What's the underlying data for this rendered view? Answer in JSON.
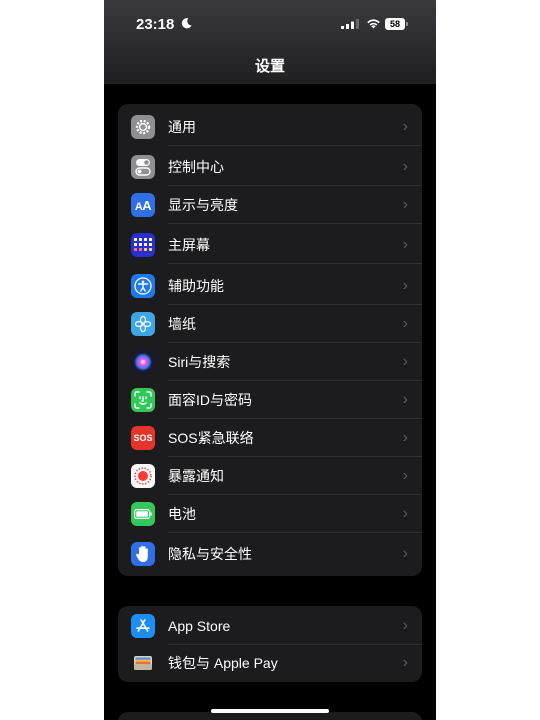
{
  "status": {
    "time": "23:18",
    "battery": "58"
  },
  "nav": {
    "title": "设置"
  },
  "group1": [
    {
      "label": "通用",
      "icon": "gear-icon",
      "color": "#8e8e93"
    },
    {
      "label": "控制中心",
      "icon": "toggles-icon",
      "color": "#8e8e93"
    },
    {
      "label": "显示与亮度",
      "icon": "text-size-icon",
      "color": "#2f6fe8"
    },
    {
      "label": "主屏幕",
      "icon": "home-grid-icon",
      "color": "#2a2fd0"
    },
    {
      "label": "辅助功能",
      "icon": "accessibility-icon",
      "color": "#1f78ee"
    },
    {
      "label": "墙纸",
      "icon": "flower-icon",
      "color": "#3ea6e5"
    },
    {
      "label": "Siri与搜索",
      "icon": "siri-icon",
      "color": "#1a1a2e"
    },
    {
      "label": "面容ID与密码",
      "icon": "face-id-icon",
      "color": "#33c759"
    },
    {
      "label": "SOS紧急联络",
      "icon": "sos-icon",
      "color": "#e5352b",
      "icon_text": "SOS"
    },
    {
      "label": "暴露通知",
      "icon": "exposure-icon",
      "color": "#ffffff"
    },
    {
      "label": "电池",
      "icon": "battery-icon",
      "color": "#34c759"
    },
    {
      "label": "隐私与安全性",
      "icon": "hand-icon",
      "color": "#2f6fe8"
    }
  ],
  "group2": [
    {
      "label": "App Store",
      "icon": "app-store-icon",
      "color": "#1e8ef7"
    },
    {
      "label": "钱包与 Apple Pay",
      "icon": "wallet-icon",
      "color": "#1c1c1e"
    }
  ]
}
